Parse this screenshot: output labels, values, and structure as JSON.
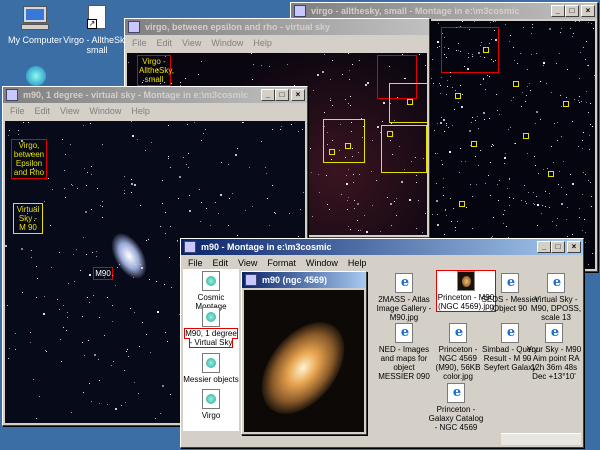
{
  "desktop": {
    "icons": [
      {
        "label": "My Computer"
      },
      {
        "label": "Virgo - AlltheSky, small"
      }
    ]
  },
  "win_allsky": {
    "title": "virgo - allthesky, small - Montage in e:\\m3cosmic"
  },
  "win_epsilon": {
    "title": "virgo, between epsilon and rho - virtual sky",
    "menu": [
      "File",
      "Edit",
      "View",
      "Window",
      "Help"
    ],
    "label": "Virgo - AlltheSky, small"
  },
  "win_m90deg": {
    "title": "m90, 1 degree - virtual sky - Montage in e:\\m3cosmic",
    "menu": [
      "File",
      "Edit",
      "View",
      "Window",
      "Help"
    ],
    "labels": {
      "epsilon": "Virgo, between Epsilon and Rho",
      "virtual": "Virtual Sky - M 90",
      "m90": "M90"
    }
  },
  "win_montage": {
    "title": "m90 - Montage in e:\\m3cosmic",
    "menu": [
      "File",
      "Edit",
      "View",
      "Format",
      "Window",
      "Help"
    ],
    "left_items": [
      {
        "label": "Cosmic Montage"
      },
      {
        "label": "M90, 1 degree - Virtual Sky"
      },
      {
        "label": "Messier objects"
      },
      {
        "label": "Virgo"
      }
    ],
    "preview_title": "m90 (ngc 4569)",
    "items": [
      {
        "label": "2MASS - Atlas Image Gallery - M90.jpg"
      },
      {
        "label": "Princeton - M90 (NGC 4569).jpg"
      },
      {
        "label": "SEDS - Messier Object 90"
      },
      {
        "label": "Virtual Sky - M90, DPOSS, scale 13"
      },
      {
        "label": "NED - Images and maps for object MESSIER 090"
      },
      {
        "label": "Princeton - NGC 4569 (M90), 56KB color.jpg"
      },
      {
        "label": "Simbad - Query Result - M 90 - Seyfert Galaxy"
      },
      {
        "label": "Your Sky - M90 - Aim point RA 12h 36m 48s Dec +13°10'"
      },
      {
        "label": "Princeton - Galaxy Catalog - NGC 4569"
      }
    ]
  },
  "title_buttons": {
    "min": "_",
    "max": "□",
    "close": "×"
  }
}
